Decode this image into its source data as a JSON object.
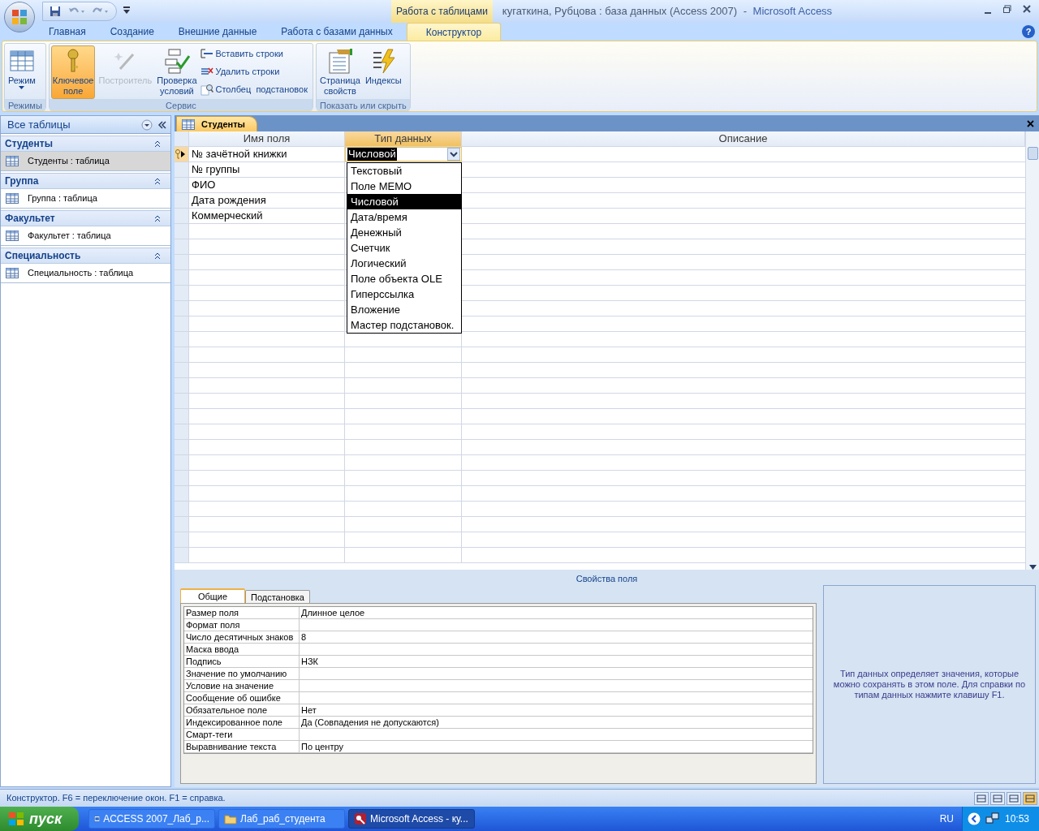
{
  "title_bar": {
    "context_tab": "Работа с таблицами",
    "document": "кугаткина, Рубцова : база данных (Access 2007)",
    "separator": "-",
    "app": "Microsoft Access"
  },
  "help_button": "?",
  "ribbon_tabs": [
    {
      "label": "Главная",
      "selected": false
    },
    {
      "label": "Создание",
      "selected": false
    },
    {
      "label": "Внешние данные",
      "selected": false
    },
    {
      "label": "Работа с базами данных",
      "selected": false
    },
    {
      "label": "Конструктор",
      "selected": true
    }
  ],
  "ribbon_groups": [
    {
      "label": "Режимы",
      "buttons": [
        {
          "label": "Режим",
          "kind": "large",
          "selected": false,
          "disabled": false,
          "dropdown": true
        }
      ]
    },
    {
      "label": "Сервис",
      "buttons": [
        {
          "label": "Ключевое\nполе",
          "kind": "large",
          "selected": true,
          "disabled": false
        },
        {
          "label": "Построитель",
          "kind": "large",
          "selected": false,
          "disabled": true
        },
        {
          "label": "Проверка\nусловий",
          "kind": "large",
          "selected": false,
          "disabled": false
        },
        {
          "label": "Вставить строки",
          "kind": "small",
          "selected": false,
          "disabled": false
        },
        {
          "label": "Удалить строки",
          "kind": "small",
          "selected": false,
          "disabled": false
        },
        {
          "label": "Столбец  подстановок",
          "kind": "small",
          "selected": false,
          "disabled": false
        }
      ]
    },
    {
      "label": "Показать или скрыть",
      "buttons": [
        {
          "label": "Страница\nсвойств",
          "kind": "large",
          "selected": false,
          "disabled": false
        },
        {
          "label": "Индексы",
          "kind": "large",
          "selected": false,
          "disabled": false
        }
      ]
    }
  ],
  "nav_pane": {
    "title": "Все таблицы",
    "groups": [
      {
        "label": "Студенты",
        "items": [
          {
            "label": "Студенты : таблица",
            "selected": true
          }
        ]
      },
      {
        "label": "Группа",
        "items": [
          {
            "label": "Группа : таблица",
            "selected": false
          }
        ]
      },
      {
        "label": "Факультет",
        "items": [
          {
            "label": "Факультет : таблица",
            "selected": false
          }
        ]
      },
      {
        "label": "Специальность",
        "items": [
          {
            "label": "Специальность : таблица",
            "selected": false
          }
        ]
      }
    ]
  },
  "document_tab": {
    "label": "Студенты"
  },
  "design_grid": {
    "columns": [
      "Имя поля",
      "Тип данных",
      "Описание"
    ],
    "rows": [
      {
        "field": "№ зачётной книжки",
        "type": "Числовой",
        "current": true,
        "primary_key": true
      },
      {
        "field": "№ группы",
        "type": "",
        "current": false,
        "primary_key": false
      },
      {
        "field": "ФИО",
        "type": "",
        "current": false,
        "primary_key": false
      },
      {
        "field": "Дата рождения",
        "type": "",
        "current": false,
        "primary_key": false
      },
      {
        "field": "Коммерческий",
        "type": "",
        "current": false,
        "primary_key": false
      }
    ],
    "type_dropdown": [
      {
        "label": "Текстовый",
        "selected": false
      },
      {
        "label": "Поле MEMO",
        "selected": false
      },
      {
        "label": "Числовой",
        "selected": true
      },
      {
        "label": "Дата/время",
        "selected": false
      },
      {
        "label": "Денежный",
        "selected": false
      },
      {
        "label": "Счетчик",
        "selected": false
      },
      {
        "label": "Логический",
        "selected": false
      },
      {
        "label": "Поле объекта OLE",
        "selected": false
      },
      {
        "label": "Гиперссылка",
        "selected": false
      },
      {
        "label": "Вложение",
        "selected": false
      },
      {
        "label": "Мастер подстановок.",
        "selected": false
      }
    ]
  },
  "field_properties": {
    "title": "Свойства поля",
    "tabs": [
      {
        "label": "Общие",
        "selected": true
      },
      {
        "label": "Подстановка",
        "selected": false
      }
    ],
    "rows": [
      {
        "name": "Размер поля",
        "value": "Длинное целое"
      },
      {
        "name": "Формат поля",
        "value": ""
      },
      {
        "name": "Число десятичных знаков",
        "value": "8"
      },
      {
        "name": "Маска ввода",
        "value": ""
      },
      {
        "name": "Подпись",
        "value": "НЗК"
      },
      {
        "name": "Значение по умолчанию",
        "value": ""
      },
      {
        "name": "Условие на значение",
        "value": ""
      },
      {
        "name": "Сообщение об ошибке",
        "value": ""
      },
      {
        "name": "Обязательное поле",
        "value": "Нет"
      },
      {
        "name": "Индексированное поле",
        "value": "Да (Совпадения не допускаются)"
      },
      {
        "name": "Смарт-теги",
        "value": ""
      },
      {
        "name": "Выравнивание текста",
        "value": "По центру"
      }
    ],
    "help": "Тип данных определяет значения, которые можно сохранять в этом поле.  Для справки по типам данных нажмите клавишу F1."
  },
  "status_bar": "Конструктор.  F6 = переключение окон.  F1 = справка.",
  "taskbar": {
    "start": "пуск",
    "tasks": [
      {
        "label": "ACCESS 2007_Лаб_р...",
        "selected": false
      },
      {
        "label": "Лаб_раб_студента",
        "selected": false
      },
      {
        "label": "Microsoft Access - ку...",
        "selected": true
      }
    ],
    "language": "RU",
    "clock": "10:53"
  }
}
